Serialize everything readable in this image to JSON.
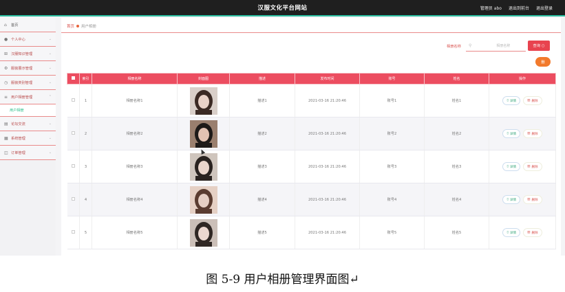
{
  "app": {
    "title": "汉服文化平台网站",
    "user_label": "管理员 abo",
    "to_frontend": "退出到前台",
    "logout": "退出登录"
  },
  "sidebar": {
    "items": [
      {
        "label": "首页",
        "icon": "home-icon"
      },
      {
        "label": "个人中心",
        "icon": "user-icon"
      },
      {
        "label": "汉服知识管理",
        "icon": "grid-icon"
      },
      {
        "label": "服装展示管理",
        "icon": "gear-icon"
      },
      {
        "label": "服装类别管理",
        "icon": "clock-icon"
      },
      {
        "label": "用户相册管理",
        "icon": "list-icon"
      },
      {
        "label": "论坛交流",
        "icon": "chat-icon"
      },
      {
        "label": "系统管理",
        "icon": "settings-icon"
      },
      {
        "label": "订单管理",
        "icon": "cart-icon"
      }
    ],
    "submenu_label": "用户相册"
  },
  "breadcrumb": {
    "home": "首页",
    "current": "用户相册"
  },
  "search": {
    "label": "相册名称",
    "placeholder": "相册名称",
    "query_button": "查询",
    "delete_button": "删"
  },
  "table": {
    "headers": [
      "",
      "索引",
      "相册名称",
      "封面图",
      "描述",
      "发布时间",
      "账号",
      "姓名",
      "操作"
    ],
    "rows": [
      {
        "index": "1",
        "name": "相册名称1",
        "desc": "描述1",
        "time": "2021-03-16 21:20:46",
        "account": "账号1",
        "realname": "姓名1"
      },
      {
        "index": "2",
        "name": "相册名称2",
        "desc": "描述2",
        "time": "2021-03-16 21:20:46",
        "account": "账号2",
        "realname": "姓名2"
      },
      {
        "index": "3",
        "name": "相册名称3",
        "desc": "描述3",
        "time": "2021-03-16 21:20:46",
        "account": "账号3",
        "realname": "姓名3"
      },
      {
        "index": "4",
        "name": "相册名称4",
        "desc": "描述4",
        "time": "2021-03-16 21:20:46",
        "account": "账号4",
        "realname": "姓名4"
      },
      {
        "index": "5",
        "name": "相册名称5",
        "desc": "描述5",
        "time": "2021-03-16 21:20:46",
        "account": "账号5",
        "realname": "姓名5"
      }
    ],
    "detail_label": "详情",
    "delete_label": "删除"
  },
  "caption": "图 5-9 用户相册管理界面图↵",
  "colors": {
    "accent": "#ec4d60",
    "topbar": "#1f1f1f",
    "orange": "#f27a2c"
  }
}
